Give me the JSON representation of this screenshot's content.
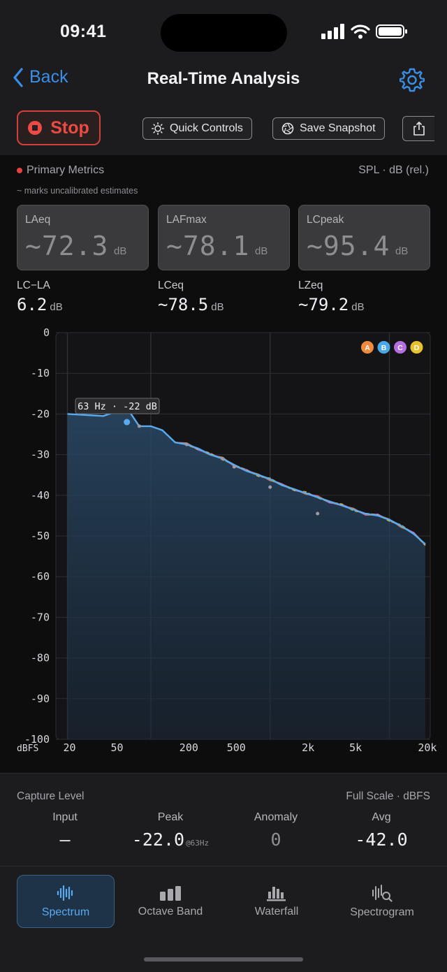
{
  "status": {
    "time": "09:41"
  },
  "nav": {
    "back_label": "Back",
    "title": "Real-Time Analysis"
  },
  "toolbar": {
    "stop_label": "Stop",
    "quick_controls_label": "Quick Controls",
    "save_snapshot_label": "Save Snapshot"
  },
  "metrics": {
    "header": "Primary Metrics",
    "unit_label": "SPL · dB (rel.)",
    "note": "~ marks uncalibrated estimates",
    "cards": [
      {
        "label": "LAeq",
        "value": "~72.3",
        "unit": "dB"
      },
      {
        "label": "LAFmax",
        "value": "~78.1",
        "unit": "dB"
      },
      {
        "label": "LCpeak",
        "value": "~95.4",
        "unit": "dB"
      }
    ],
    "secondary": [
      {
        "label": "LC−LA",
        "value": "6.2",
        "unit": "dB"
      },
      {
        "label": "LCeq",
        "value": "~78.5",
        "unit": "dB"
      },
      {
        "label": "LZeq",
        "value": "~79.2",
        "unit": "dB"
      }
    ]
  },
  "chart_data": {
    "type": "line",
    "title": "",
    "ylabel": "dBFS",
    "xlabel": "",
    "x_scale": "log",
    "xlim": [
      16,
      22000
    ],
    "ylim": [
      -100,
      0
    ],
    "x_ticks": [
      20,
      50,
      200,
      500,
      2000,
      5000,
      20000
    ],
    "x_tick_labels": [
      "20",
      "50",
      "200",
      "500",
      "2k",
      "5k",
      "20k"
    ],
    "y_ticks": [
      0,
      -10,
      -20,
      -30,
      -40,
      -50,
      -60,
      -70,
      -80,
      -90,
      -100
    ],
    "grid": true,
    "tooltip": "63 Hz · -22 dB",
    "legend_markers": [
      "A",
      "B",
      "C",
      "D"
    ],
    "series": [
      {
        "x": [
          20,
          40,
          63,
          80,
          100,
          125,
          160,
          200,
          250,
          315,
          400,
          500,
          630,
          800,
          1000,
          1250,
          1600,
          2000,
          2500,
          3150,
          4000,
          5000,
          6300,
          8000,
          10000,
          12500,
          16000,
          20000
        ],
        "values": [
          -20,
          -20.5,
          -18.5,
          -23,
          -23,
          -24,
          -27,
          -27.5,
          -28.5,
          -30,
          -31,
          -32.5,
          -34,
          -35,
          -36,
          -37.5,
          -38.5,
          -39.5,
          -40.5,
          -41.5,
          -42.5,
          -43.5,
          -44.5,
          -45,
          -46,
          -47.5,
          -49.5,
          -52
        ]
      },
      {
        "x": [
          63,
          80,
          200,
          400,
          500,
          1000,
          2500
        ],
        "values": [
          -22,
          -23,
          -27.5,
          -31,
          -33,
          -38,
          -44.5
        ]
      }
    ],
    "colors": {
      "spectrum": "#5aaaf0",
      "a": "#f08a3c",
      "b": "#4aa8e8",
      "c": "#b46ee0",
      "d": "#e8c22c",
      "grid": "#2e2e32"
    }
  },
  "capture": {
    "title": "Capture Level",
    "scale": "Full Scale · dBFS",
    "input_label": "Input",
    "input_value": "—",
    "peak_label": "Peak",
    "peak_value": "-22.0",
    "peak_note": "@63Hz",
    "anomaly_label": "Anomaly",
    "anomaly_value": "0",
    "avg_label": "Avg",
    "avg_value": "-42.0"
  },
  "tabs": [
    {
      "label": "Spectrum",
      "icon": "waveform-icon",
      "active": true
    },
    {
      "label": "Octave Band",
      "icon": "octave-bars-icon"
    },
    {
      "label": "Waterfall",
      "icon": "waterfall-icon"
    },
    {
      "label": "Spectrogram",
      "icon": "spectrogram-icon"
    }
  ]
}
